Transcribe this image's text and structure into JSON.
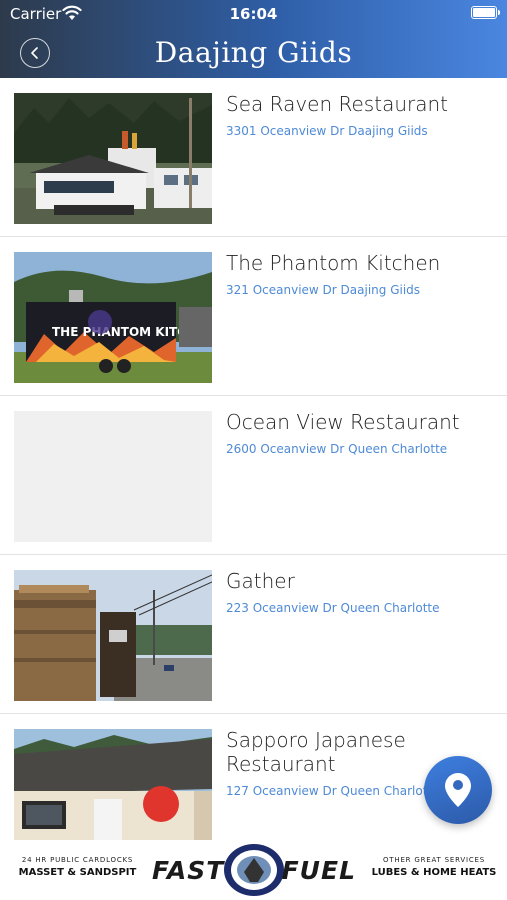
{
  "status_bar": {
    "carrier": "Carrier",
    "time": "16:04"
  },
  "header": {
    "title": "Daajing Giids",
    "back_icon": "chevron-left-icon"
  },
  "restaurants": [
    {
      "name": "Sea Raven Restaurant",
      "address": "3301 Oceanview Dr Daajing Giids"
    },
    {
      "name": "The Phantom Kitchen",
      "address": "321 Oceanview Dr Daajing Giids"
    },
    {
      "name": "Ocean View Restaurant",
      "address": "2600 Oceanview Dr Queen Charlotte"
    },
    {
      "name": "Gather",
      "address": "223 Oceanview Dr Queen Charlotte"
    },
    {
      "name": "Sapporo Japanese Restaurant",
      "address": "127 Oceanview Dr Queen Charlotte"
    }
  ],
  "phantom_truck_sign": "THE PHANTOM KITCHEN",
  "map_button": {
    "icon": "map-pin-icon"
  },
  "ad": {
    "left_small": "24 HR PUBLIC CARDLOCKS",
    "left_big": "MASSET & SANDSPIT",
    "brand_word1": "FAST",
    "brand_word2": "FUEL",
    "right_small": "OTHER GREAT SERVICES",
    "right_big": "LUBES & HOME HEATS"
  },
  "colors": {
    "header_start": "#2d3a4b",
    "header_end": "#4a86e0",
    "address": "#4e8ad6",
    "fab": "#3e7fe0"
  }
}
